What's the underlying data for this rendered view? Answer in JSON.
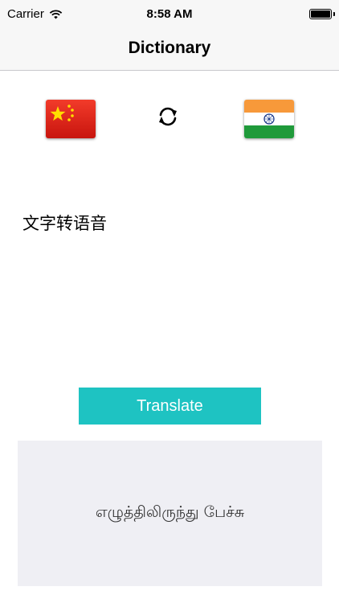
{
  "status_bar": {
    "carrier": "Carrier",
    "time": "8:58 AM",
    "battery_level": 1.0
  },
  "nav": {
    "title": "Dictionary"
  },
  "languages": {
    "source_flag": "china-flag-icon",
    "target_flag": "india-flag-icon",
    "swap": "swap-arrows-icon"
  },
  "input": {
    "text": "文字转语音"
  },
  "translate_button": {
    "label": "Translate",
    "color": "#1ec3c2"
  },
  "result": {
    "text": "எழுத்திலிருந்து பேச்சு",
    "background": "#efeff4"
  }
}
